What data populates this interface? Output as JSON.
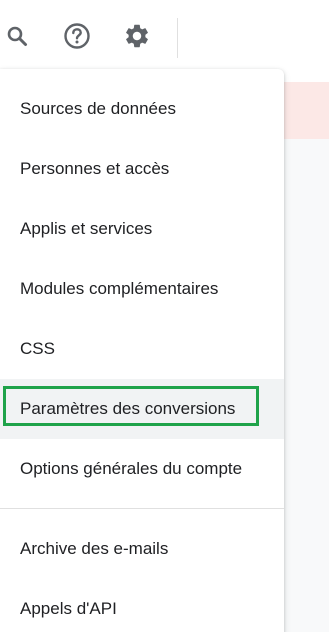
{
  "toolbar": {
    "buttons": [
      {
        "icon": "search-icon"
      },
      {
        "icon": "help-circle-icon"
      },
      {
        "icon": "gear-icon"
      }
    ]
  },
  "menu": {
    "items": [
      {
        "label": "Sources de données"
      },
      {
        "label": "Personnes et accès"
      },
      {
        "label": "Applis et services"
      },
      {
        "label": "Modules complémentaires"
      },
      {
        "label": "CSS"
      },
      {
        "label": "Paramètres des conversions",
        "selected": true
      },
      {
        "label": "Options générales du compte"
      },
      {
        "label": "Archive des e-mails"
      },
      {
        "label": "Appels d'API"
      }
    ]
  },
  "colors": {
    "highlight_border": "#1fa34a",
    "selected_bg": "#f1f3f4",
    "background_banner": "#fce8e6",
    "icon": "#5f6368",
    "text": "#202124"
  }
}
